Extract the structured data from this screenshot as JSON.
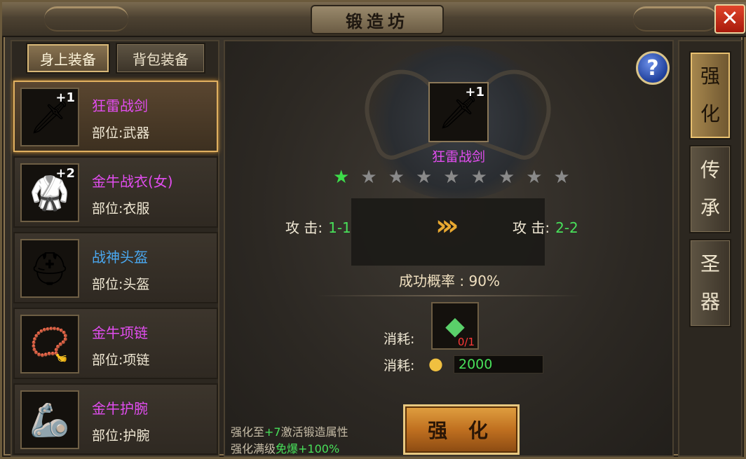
{
  "window": {
    "title": "锻造坊",
    "close_label": "✕"
  },
  "left_tabs": [
    {
      "label": "身上装备",
      "active": true
    },
    {
      "label": "背包装备",
      "active": false
    }
  ],
  "equipment": [
    {
      "name": "狂雷战剑",
      "slot": "部位:武器",
      "plus": "+1",
      "name_color": "#e24df0",
      "icon": "sword-icon",
      "glyph": "🗡",
      "selected": true
    },
    {
      "name": "金牛战衣(女)",
      "slot": "部位:衣服",
      "plus": "+2",
      "name_color": "#e24df0",
      "icon": "armor-icon",
      "glyph": "🥋",
      "selected": false
    },
    {
      "name": "战神头盔",
      "slot": "部位:头盔",
      "plus": "",
      "name_color": "#4aa8f0",
      "icon": "helmet-icon",
      "glyph": "⛑",
      "selected": false
    },
    {
      "name": "金牛项链",
      "slot": "部位:项链",
      "plus": "",
      "name_color": "#e24df0",
      "icon": "necklace-icon",
      "glyph": "📿",
      "selected": false
    },
    {
      "name": "金牛护腕",
      "slot": "部位:护腕",
      "plus": "",
      "name_color": "#e24df0",
      "icon": "bracer-icon",
      "glyph": "🦾",
      "selected": false
    }
  ],
  "forge": {
    "item_name": "狂雷战剑",
    "item_plus": "+1",
    "item_icon": "sword-icon",
    "stars_total": 9,
    "stars_filled": 1,
    "stat_label": "攻 击:",
    "current_value": "1-1",
    "next_value": "2-2",
    "success_rate_label": "成功概率 : 90%",
    "cost_label": "消耗:",
    "gem_icon": "gem-icon",
    "gem_count": "0/1",
    "gold_icon": "gold-ingot-icon",
    "gold_amount": "2000",
    "button_label": "强 化",
    "help_label": "?",
    "tip1_prefix": "强化至",
    "tip1_highlight": "+7",
    "tip1_suffix": "激活锻造属性",
    "tip2_prefix": "强化满级",
    "tip2_highlight": "免爆+100%"
  },
  "side_tabs": [
    {
      "label_top": "强",
      "label_bottom": "化",
      "active": true
    },
    {
      "label_top": "传",
      "label_bottom": "承",
      "active": false
    },
    {
      "label_top": "圣",
      "label_bottom": "器",
      "active": false
    }
  ],
  "colors": {
    "accent": "#e0b060",
    "success_green": "#48e05a",
    "purple_name": "#e24df0",
    "blue_name": "#4aa8f0"
  }
}
